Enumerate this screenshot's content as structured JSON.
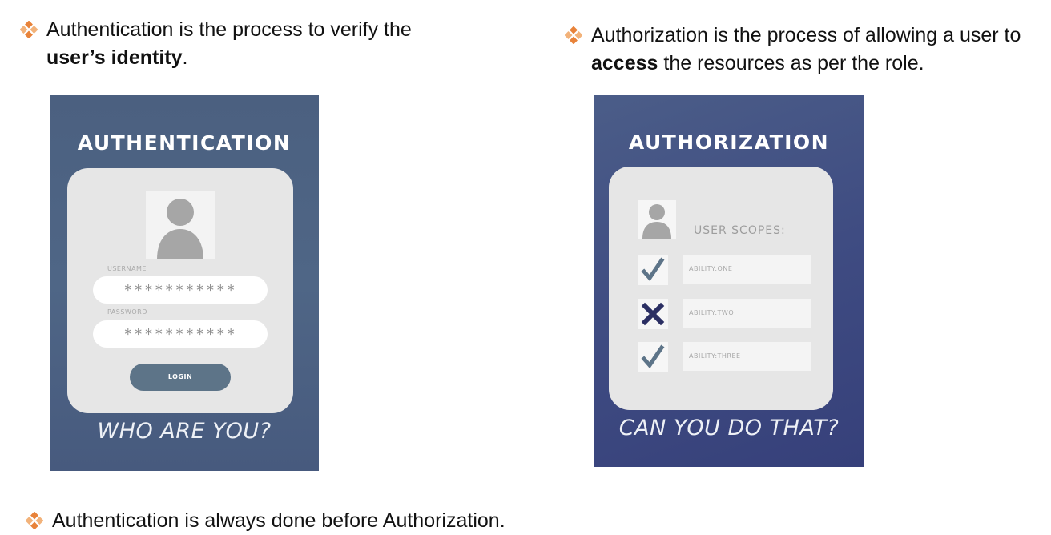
{
  "colors": {
    "bullet_orange": "#e8833a",
    "authn_card_bg": "#4e6585",
    "authz_card_bg": "#3d4a80",
    "panel_bg": "#e6e6e6",
    "login_button_bg": "#5d7488",
    "check_color": "#5d7488",
    "cross_color": "#2b2f63"
  },
  "bullets": {
    "authn": {
      "line1": "Authentication is the process to verify the",
      "bold": "user’s identity",
      "after": "."
    },
    "authz": {
      "line1": "Authorization is the process of allowing a user to",
      "bold": "access",
      "after": " the resources as per the role."
    },
    "order": {
      "text": "Authentication is always done before Authorization."
    }
  },
  "authn_card": {
    "title": "AUTHENTICATION",
    "avatar_icon": "user-silhouette-icon",
    "username_label": "USERNAME",
    "username_value": "***********",
    "password_label": "PASSWORD",
    "password_value": "***********",
    "login_label": "LOGIN",
    "footer": "WHO ARE YOU?"
  },
  "authz_card": {
    "title": "AUTHORIZATION",
    "avatar_icon": "user-silhouette-icon",
    "scopes_heading": "USER SCOPES:",
    "scopes": [
      {
        "label": "ABILITY:ONE",
        "mark": "check-icon"
      },
      {
        "label": "ABILITY:TWO",
        "mark": "cross-icon"
      },
      {
        "label": "ABILITY:THREE",
        "mark": "check-icon"
      }
    ],
    "footer": "CAN YOU DO THAT?"
  }
}
